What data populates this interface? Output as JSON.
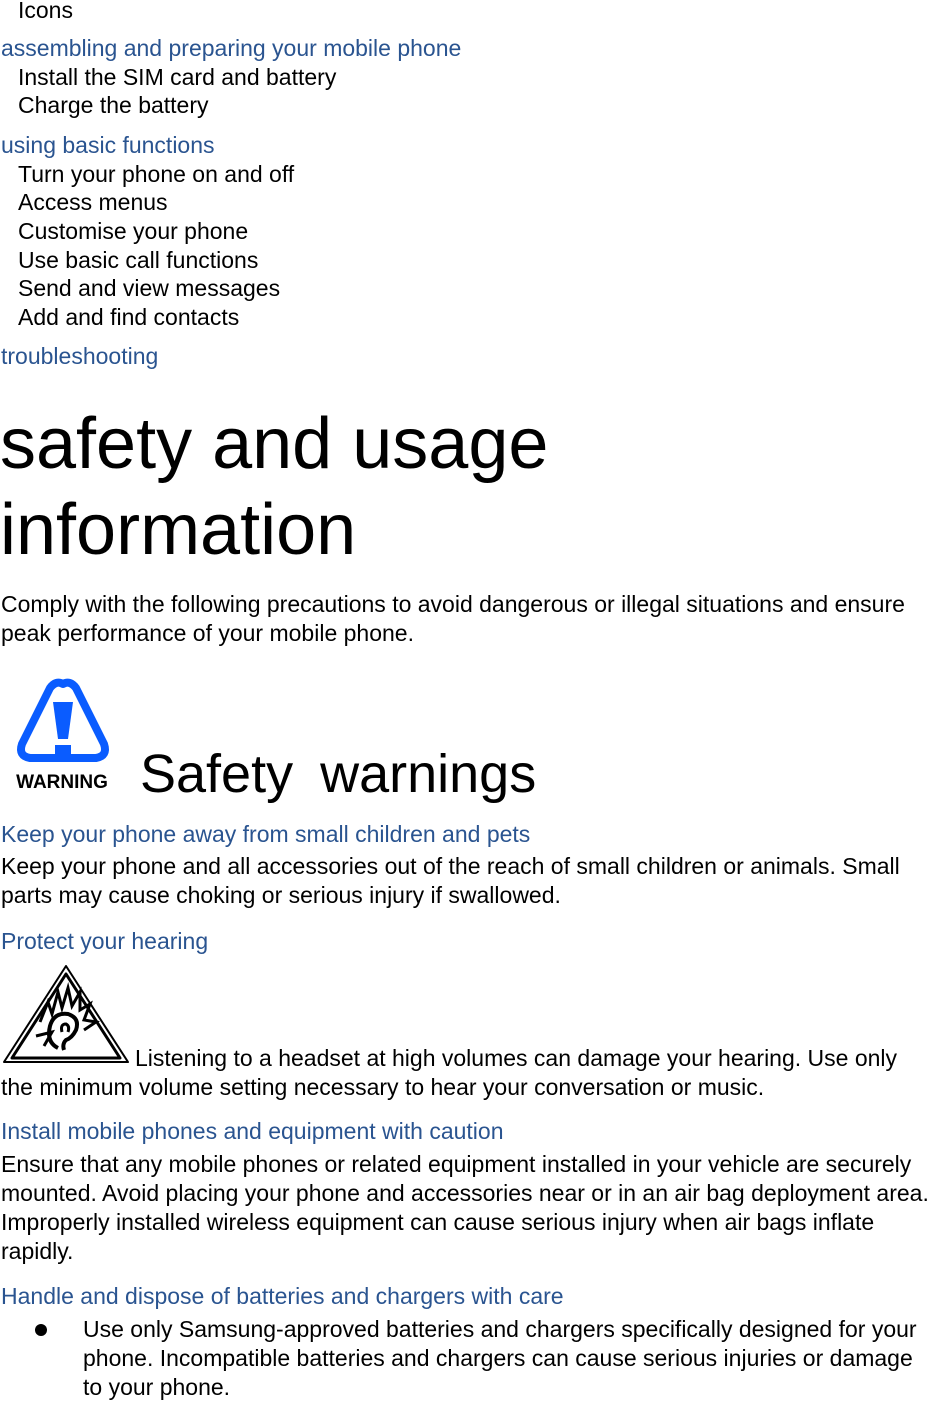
{
  "toc": {
    "top_item": "Icons",
    "sections": [
      {
        "heading": "assembling and preparing your mobile phone",
        "items": [
          "Install the SIM card and battery",
          "Charge the battery"
        ]
      },
      {
        "heading": "using basic functions",
        "items": [
          "Turn your phone on and off",
          "Access menus",
          "Customise your phone",
          "Use basic call functions",
          "Send and view messages",
          "Add and find contacts"
        ]
      },
      {
        "heading": "troubleshooting",
        "items": []
      }
    ]
  },
  "main": {
    "title_line1": "safety and usage",
    "title_line2": "information",
    "intro": "Comply with the following precautions to avoid dangerous or illegal situations and ensure peak performance of your mobile phone.",
    "warning_icon_label": "WARNING",
    "section_title": "Safety  warnings",
    "subsections": [
      {
        "heading": "Keep your phone away from small children and pets",
        "text": "Keep your phone and all accessories out of the reach of small children or animals. Small parts may cause choking or serious injury if swallowed."
      },
      {
        "heading": "Protect your hearing",
        "text": "Listening to a headset at high volumes can damage your hearing. Use only the minimum volume setting necessary to hear your conversation or music."
      },
      {
        "heading": "Install mobile phones and equipment with caution",
        "text": "Ensure that any mobile phones or related equipment installed in your vehicle are securely mounted. Avoid placing your phone and accessories near or in an air bag deployment area. Improperly installed wireless equipment can cause serious injury when air bags inflate rapidly."
      },
      {
        "heading": "Handle and dispose of batteries and chargers with care",
        "bullets": [
          "Use only Samsung-approved batteries and chargers specifically designed for your phone. Incompatible batteries and chargers can cause serious injuries or damage to your phone."
        ]
      }
    ]
  },
  "colors": {
    "heading_blue": "#2a5490",
    "warning_blue": "#0a5cff"
  }
}
